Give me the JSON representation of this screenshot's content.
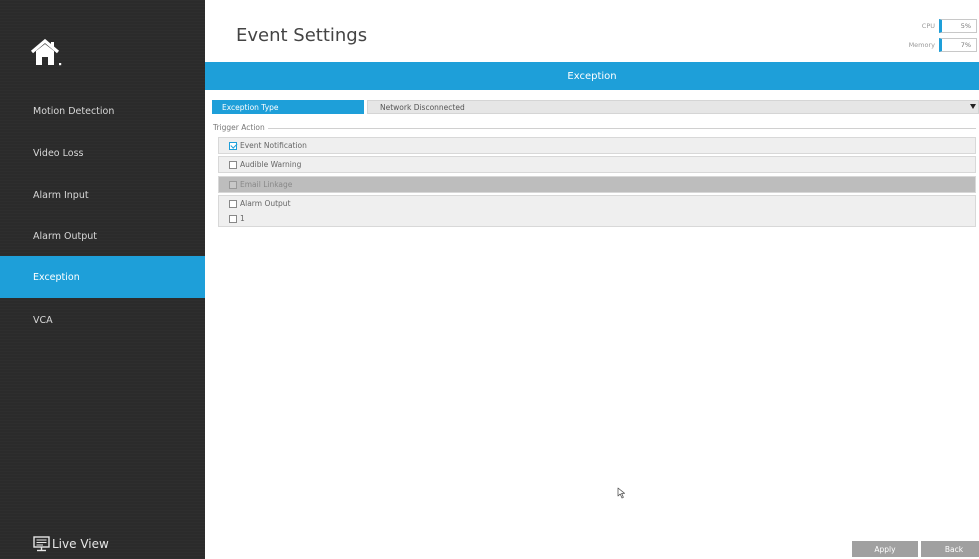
{
  "sidebar": {
    "items": [
      {
        "label": "Motion Detection",
        "active": false
      },
      {
        "label": "Video Loss",
        "active": false
      },
      {
        "label": "Alarm Input",
        "active": false
      },
      {
        "label": "Alarm Output",
        "active": false
      },
      {
        "label": "Exception",
        "active": true
      },
      {
        "label": "VCA",
        "active": false
      }
    ],
    "live_view_label": "Live View"
  },
  "header": {
    "title": "Event Settings",
    "cpu_label": "CPU",
    "cpu_value": "5%",
    "memory_label": "Memory",
    "memory_value": "7%"
  },
  "section": {
    "title": "Exception"
  },
  "exception_type": {
    "label": "Exception Type",
    "value": "Network Disconnected"
  },
  "trigger_action": {
    "legend": "Trigger Action",
    "event_notification": {
      "label": "Event Notification",
      "checked": true
    },
    "audible_warning": {
      "label": "Audible Warning",
      "checked": false
    },
    "email_linkage": {
      "label": "Email Linkage",
      "checked": false,
      "disabled": true
    },
    "alarm_output": {
      "label": "Alarm Output",
      "checked": false
    },
    "alarm_output_1": {
      "label": "1",
      "checked": false
    }
  },
  "buttons": {
    "apply": "Apply",
    "back": "Back"
  },
  "colors": {
    "accent": "#1e9fd9",
    "sidebar_bg": "#2b2b2b",
    "button_bg": "#a0a0a0"
  },
  "icons": {
    "home": "home-icon",
    "live_view": "monitor-icon",
    "dropdown": "caret-down-icon",
    "cursor": "mouse-pointer-icon"
  }
}
